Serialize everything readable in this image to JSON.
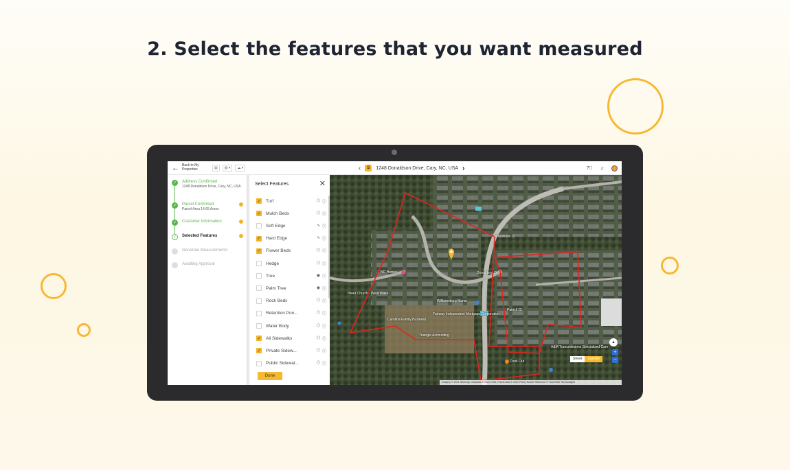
{
  "headline": "2. Select the features that you want measured",
  "colors": {
    "accent": "#f5b82e",
    "success": "#59b74a",
    "parcel_outline": "#e3241e",
    "decor_circle": "#f7b733"
  },
  "app": {
    "back": {
      "icon": "arrow-left-icon",
      "label": "Back to My Properties"
    },
    "tools": [
      "layers-icon",
      "image-icon",
      "cloud-icon"
    ],
    "address": "1248 Donaldson Drive, Cary, NC, USA",
    "top_icons": [
      "help-icon",
      "bell-icon",
      "avatar"
    ]
  },
  "steps": [
    {
      "title": "Address Confirmed",
      "subtitle": "1248 Donaldson Drive, Cary, NC, USA",
      "state": "done"
    },
    {
      "title": "Parcel Confirmed",
      "subtitle": "Parcel Area 14.65 Acres",
      "state": "done"
    },
    {
      "title": "Customer Information",
      "subtitle": "",
      "state": "done"
    },
    {
      "title": "Selected Features",
      "subtitle": "",
      "state": "current"
    },
    {
      "title": "Generate Measurements",
      "subtitle": "",
      "state": "pending"
    },
    {
      "title": "Awaiting Approval",
      "subtitle": "",
      "state": "pending"
    }
  ],
  "features_panel": {
    "title": "Select Features",
    "close_icon": "close-icon",
    "done_label": "Done",
    "items": [
      {
        "label": "Turf",
        "checked": true,
        "shape": "polygon-icon"
      },
      {
        "label": "Mulch Beds",
        "checked": true,
        "shape": "polygon-icon"
      },
      {
        "label": "Soft Edge",
        "checked": false,
        "shape": "line-icon"
      },
      {
        "label": "Hard Edge",
        "checked": true,
        "shape": "line-icon"
      },
      {
        "label": "Flower Beds",
        "checked": true,
        "shape": "polygon-icon"
      },
      {
        "label": "Hedge",
        "checked": false,
        "shape": "polygon-icon"
      },
      {
        "label": "Tree",
        "checked": false,
        "shape": "point-icon"
      },
      {
        "label": "Palm Tree",
        "checked": false,
        "shape": "point-icon"
      },
      {
        "label": "Rock Beds",
        "checked": false,
        "shape": "polygon-icon"
      },
      {
        "label": "Retention Pon...",
        "checked": false,
        "shape": "polygon-icon"
      },
      {
        "label": "Water Body",
        "checked": false,
        "shape": "polygon-icon"
      },
      {
        "label": "All Sidewalks",
        "checked": true,
        "shape": "polygon-icon"
      },
      {
        "label": "Private Sidew...",
        "checked": true,
        "shape": "polygon-icon"
      },
      {
        "label": "Public Sidewal...",
        "checked": false,
        "shape": "polygon-icon"
      }
    ]
  },
  "map": {
    "labels": [
      "NC Homes",
      "Heart Church - West Wake",
      "Williamsburg Manor",
      "Fairway Independent Mortgage Corporation",
      "Carolina Family Business",
      "Triangle Accounting",
      "Patrick Ct",
      "Cook Out",
      "A&M Transmissions Specialized Care",
      "Jamestown Ct",
      "Donaldson Dr"
    ],
    "toggle": {
      "street": "Street",
      "satellite": "Satellite",
      "active": "satellite"
    },
    "attribution": "Imagery © 2021 Nearmap, Mapdata © 2021 OSM, Parcel data © 2021 Pitney Bowes    Siterecon © FutureSite Technologies"
  }
}
